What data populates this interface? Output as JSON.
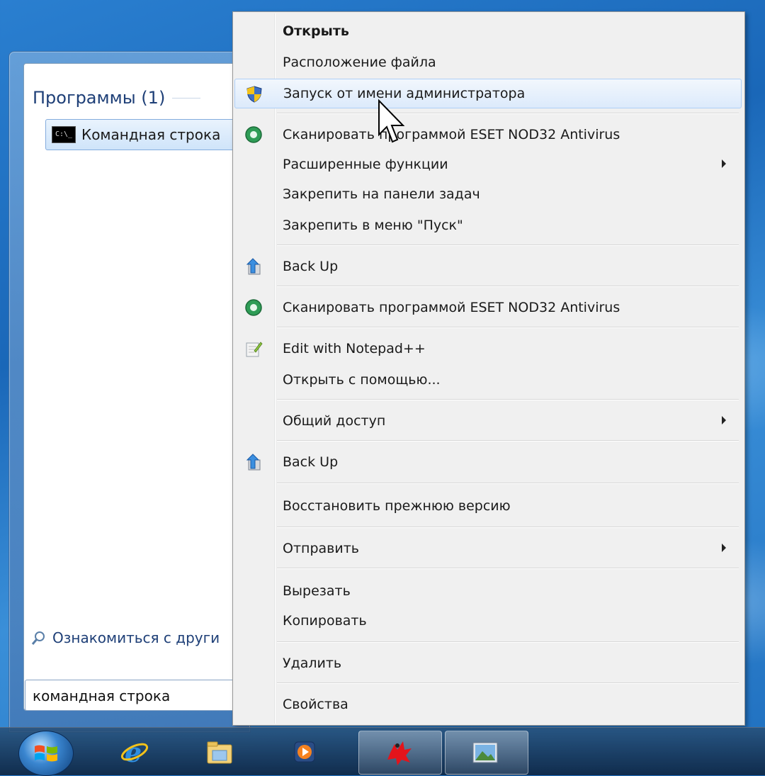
{
  "start_menu": {
    "programs_header": "Программы (1)",
    "program_item": "Командная строка",
    "see_more": "Ознакомиться с други",
    "search_value": "командная строка"
  },
  "context_menu": {
    "items": [
      {
        "label": "Открыть",
        "bold": true,
        "icon": ""
      },
      {
        "label": "Расположение файла",
        "icon": ""
      },
      {
        "label": "Запуск от имени администратора",
        "icon": "uac-shield-icon",
        "highlighted": true
      },
      {
        "label": "Сканировать программой ESET NOD32 Antivirus",
        "icon": "eset-icon"
      },
      {
        "label": "Расширенные функции",
        "icon": "",
        "submenu": true
      },
      {
        "label": "Закрепить на панели задач",
        "icon": ""
      },
      {
        "label": "Закрепить в меню \"Пуск\"",
        "icon": ""
      },
      {
        "label": "Back Up",
        "icon": "backup-icon"
      },
      {
        "label": "Сканировать программой ESET NOD32 Antivirus",
        "icon": "eset-icon"
      },
      {
        "label": "Edit with Notepad++",
        "icon": "notepadpp-icon"
      },
      {
        "label": "Открыть с помощью...",
        "icon": ""
      },
      {
        "label": "Общий доступ",
        "icon": "",
        "submenu": true
      },
      {
        "label": "Back Up",
        "icon": "backup-icon"
      },
      {
        "label": "Восстановить прежнюю версию",
        "icon": ""
      },
      {
        "label": "Отправить",
        "icon": "",
        "submenu": true
      },
      {
        "label": "Вырезать",
        "icon": ""
      },
      {
        "label": "Копировать",
        "icon": ""
      },
      {
        "label": "Удалить",
        "icon": ""
      },
      {
        "label": "Свойства",
        "icon": ""
      }
    ]
  },
  "taskbar": {
    "icons": [
      "start-orb-icon",
      "internet-explorer-icon",
      "explorer-folder-icon",
      "media-player-icon",
      "paint-app-icon",
      "picture-viewer-icon"
    ]
  },
  "colors": {
    "menu_bg": "#f0f0f0",
    "highlight_border": "#aecff7",
    "link_blue": "#1e3f77",
    "desktop_blue": "#1a67b8"
  }
}
